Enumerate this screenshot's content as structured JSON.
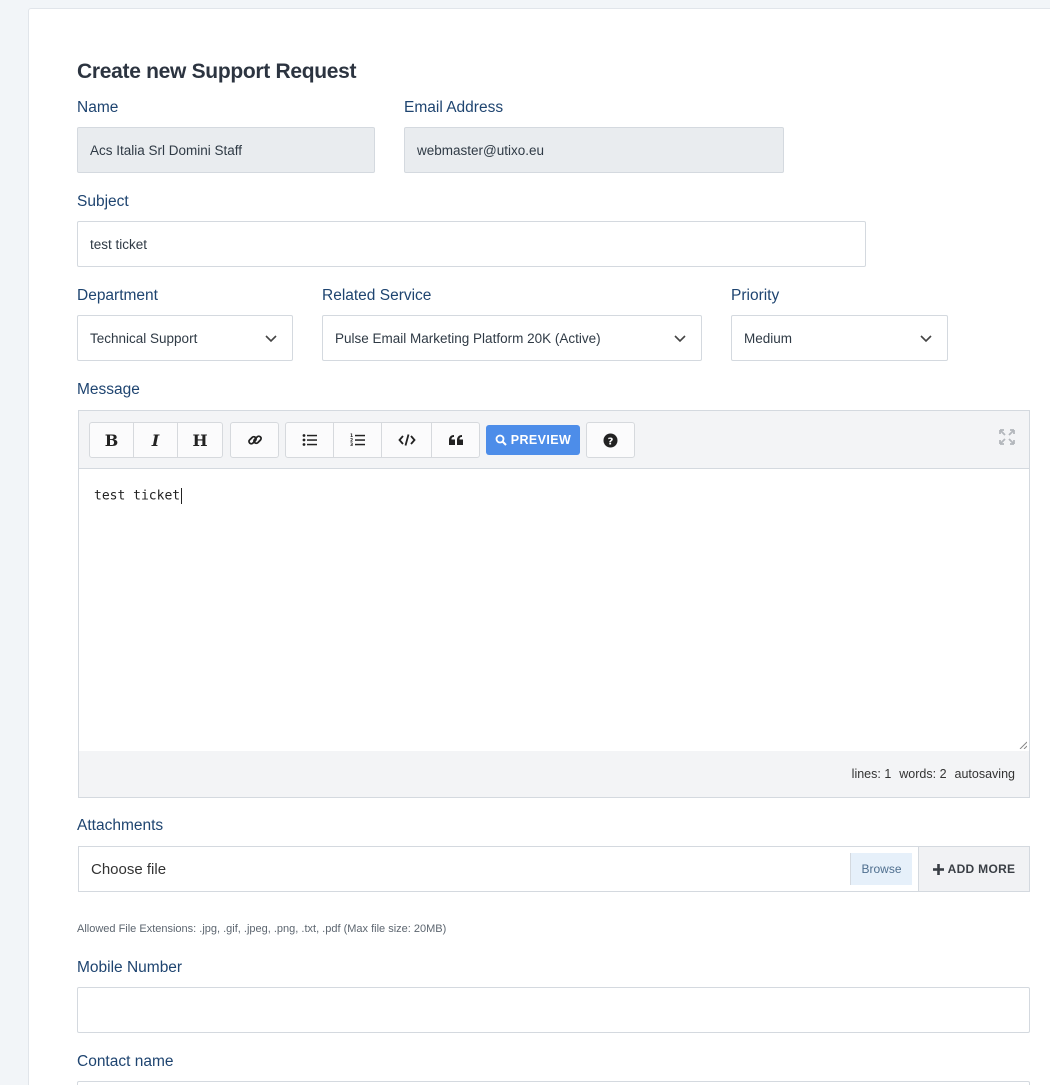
{
  "form": {
    "title": "Create new Support Request",
    "name": {
      "label": "Name",
      "value": "Acs Italia Srl Domini Staff"
    },
    "email": {
      "label": "Email Address",
      "value": "webmaster@utixo.eu"
    },
    "subject": {
      "label": "Subject",
      "value": "test ticket"
    },
    "department": {
      "label": "Department",
      "value": "Technical Support"
    },
    "related_service": {
      "label": "Related Service",
      "value": "Pulse Email Marketing Platform 20K (Active)"
    },
    "priority": {
      "label": "Priority",
      "value": "Medium"
    },
    "message": {
      "label": "Message",
      "content": "test ticket",
      "preview_label": "PREVIEW",
      "status": {
        "lines": "lines: 1",
        "words": "words: 2",
        "autosave": "autosaving"
      }
    },
    "attachments": {
      "label": "Attachments",
      "placeholder": "Choose file",
      "browse_label": "Browse",
      "add_more_label": "ADD MORE",
      "hint": "Allowed File Extensions: .jpg, .gif, .jpeg, .png, .txt, .pdf (Max file size: 20MB)"
    },
    "mobile": {
      "label": "Mobile Number",
      "value": ""
    },
    "contact_name": {
      "label": "Contact name"
    }
  },
  "toolbar_icons": [
    "bold-icon",
    "italic-icon",
    "heading-icon",
    "link-icon",
    "unordered-list-icon",
    "ordered-list-icon",
    "code-icon",
    "quote-icon",
    "search-icon",
    "help-icon",
    "fullscreen-icon"
  ],
  "colors": {
    "label": "#1e4470",
    "accent": "#4d8de9",
    "readonly_bg": "#e9ecef"
  }
}
